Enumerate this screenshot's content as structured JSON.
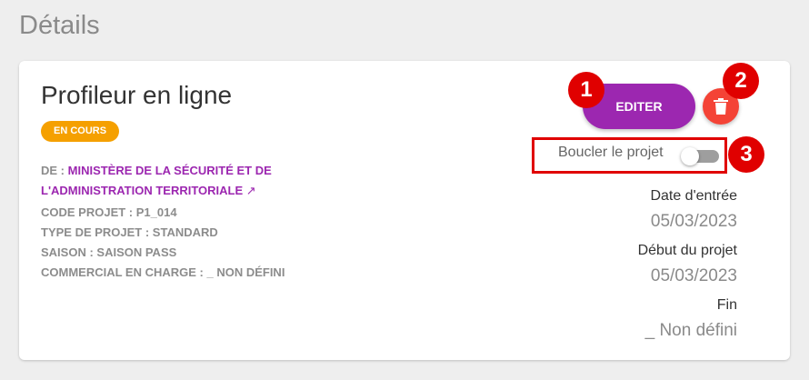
{
  "page": {
    "heading": "Détails"
  },
  "project": {
    "title": "Profileur en ligne",
    "status": "EN COURS",
    "from_label": "DE : ",
    "from_value_line1": "MINISTÈRE DE LA SÉCURITÉ ET DE",
    "from_value_line2": "L'ADMINISTRATION TERRITORIALE",
    "link_arrow": "↗",
    "code": "CODE PROJET : P1_014",
    "type": "TYPE DE PROJET : STANDARD",
    "season": "SAISON : SAISON PASS",
    "commercial": "COMMERCIAL EN CHARGE : _ NON DÉFINI"
  },
  "actions": {
    "edit_label": "EDITER",
    "delete_icon": "trash-icon",
    "toggle_label": "Boucler le projet",
    "toggle_on": false
  },
  "info": {
    "entry_date_label": "Date d'entrée",
    "entry_date_value": "05/03/2023",
    "start_label": "Début du projet",
    "start_value": "05/03/2023",
    "end_label": "Fin",
    "end_value": "_ Non défini"
  },
  "annotations": {
    "step1": "1",
    "step2": "2",
    "step3": "3"
  },
  "colors": {
    "accent": "#9c27b0",
    "delete": "#f44336",
    "status": "#f5a000",
    "annotation": "#e00000"
  }
}
